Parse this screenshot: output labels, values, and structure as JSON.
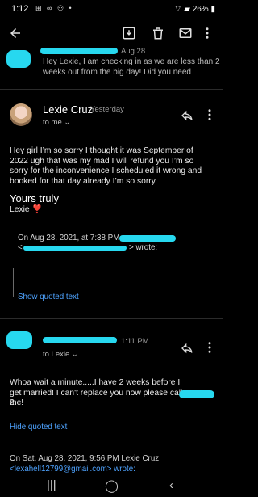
{
  "status_bar": {
    "time": "1:12",
    "left_icons": "⊞ ∞ ⚇ •",
    "battery": "26%"
  },
  "email1": {
    "date": "Aug 28",
    "preview": "Hey Lexie, I am checking in as we are less than 2 weeks out from the big day! Did you need"
  },
  "email2": {
    "sender": "Lexie Cruz",
    "date": "Yesterday",
    "recipient": "to me",
    "body": "Hey girl I’m so sorry I thought it was September of 2022 ugh that was my mad I will refund you I’m so sorry for the inconvenience I scheduled it wrong and booked for that day already I’m so sorry",
    "signature_line": "Yours truly",
    "signature_name": "Lexie",
    "signature_emoji": "❣️",
    "quote_header_line1": "On Aug 28, 2021, at 7:38 PM,",
    "quote_header_line2_suffix": "> wrote:",
    "quote_prefix": "<",
    "show_quoted": "Show quoted text"
  },
  "email3": {
    "date": "1:11 PM",
    "recipient": "to Lexie",
    "body": "Whoa wait a minute.....I have 2 weeks before I get married! I can't replace you now please call me!",
    "body_tail": "2",
    "hide_quoted": "Hide quoted text",
    "quote_line1": "On Sat, Aug 28, 2021, 9:56 PM Lexie Cruz",
    "quote_line2": "<lexahell12799@gmail.com> wrote:"
  }
}
